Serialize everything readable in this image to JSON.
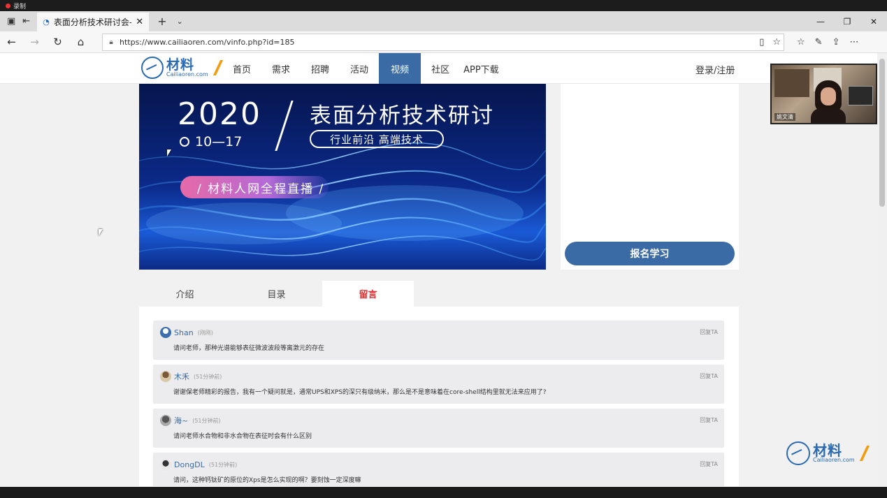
{
  "recording": {
    "label": "录制"
  },
  "browser": {
    "tab_title": "表面分析技术研讨会-视",
    "url": "https://www.cailiaoren.com/vinfo.php?id=185"
  },
  "site": {
    "logo_cn": "材料人",
    "logo_en": "Cailiaoren.com",
    "nav": [
      {
        "label": "首页"
      },
      {
        "label": "需求"
      },
      {
        "label": "招聘"
      },
      {
        "label": "活动"
      },
      {
        "label": "视频"
      },
      {
        "label": "社区"
      },
      {
        "label": "APP下载"
      }
    ],
    "active_nav": "视频",
    "login": "登录/注册"
  },
  "banner": {
    "year": "2020",
    "date": "10—17",
    "title": "表面分析技术研讨",
    "pill": "行业前沿  高端技术",
    "live": "/ 材料人网全程直播 /"
  },
  "side_panel": {
    "enroll_button": "报名学习"
  },
  "tabs": [
    {
      "label": "介绍"
    },
    {
      "label": "目录"
    },
    {
      "label": "留言"
    }
  ],
  "active_tab": "留言",
  "comments": [
    {
      "name": "Shan",
      "time": "(刚刚)",
      "reply": "回复TA",
      "body": "请问老师，那种光谱能够表征微波波段等离激元的存在"
    },
    {
      "name": "木禾",
      "time": "(51分钟前)",
      "reply": "回复TA",
      "body": "谢谢保老师精彩的报告，我有一个疑问就是，通常UPS和XPS的深只有级纳米，那么是不是意味着在core-shell结构里就无法来应用了?"
    },
    {
      "name": "海~",
      "time": "(51分钟前)",
      "reply": "回复TA",
      "body": "请问老师水合物和非水合物在表征时会有什么区别"
    },
    {
      "name": "DongDL",
      "time": "(51分钟前)",
      "reply": "回复TA",
      "body": "请问，这种钙钛矿的原位的Xps是怎么实现的啊？要刻蚀一定深度嘛"
    }
  ],
  "webcam": {
    "name": "姚文清"
  }
}
